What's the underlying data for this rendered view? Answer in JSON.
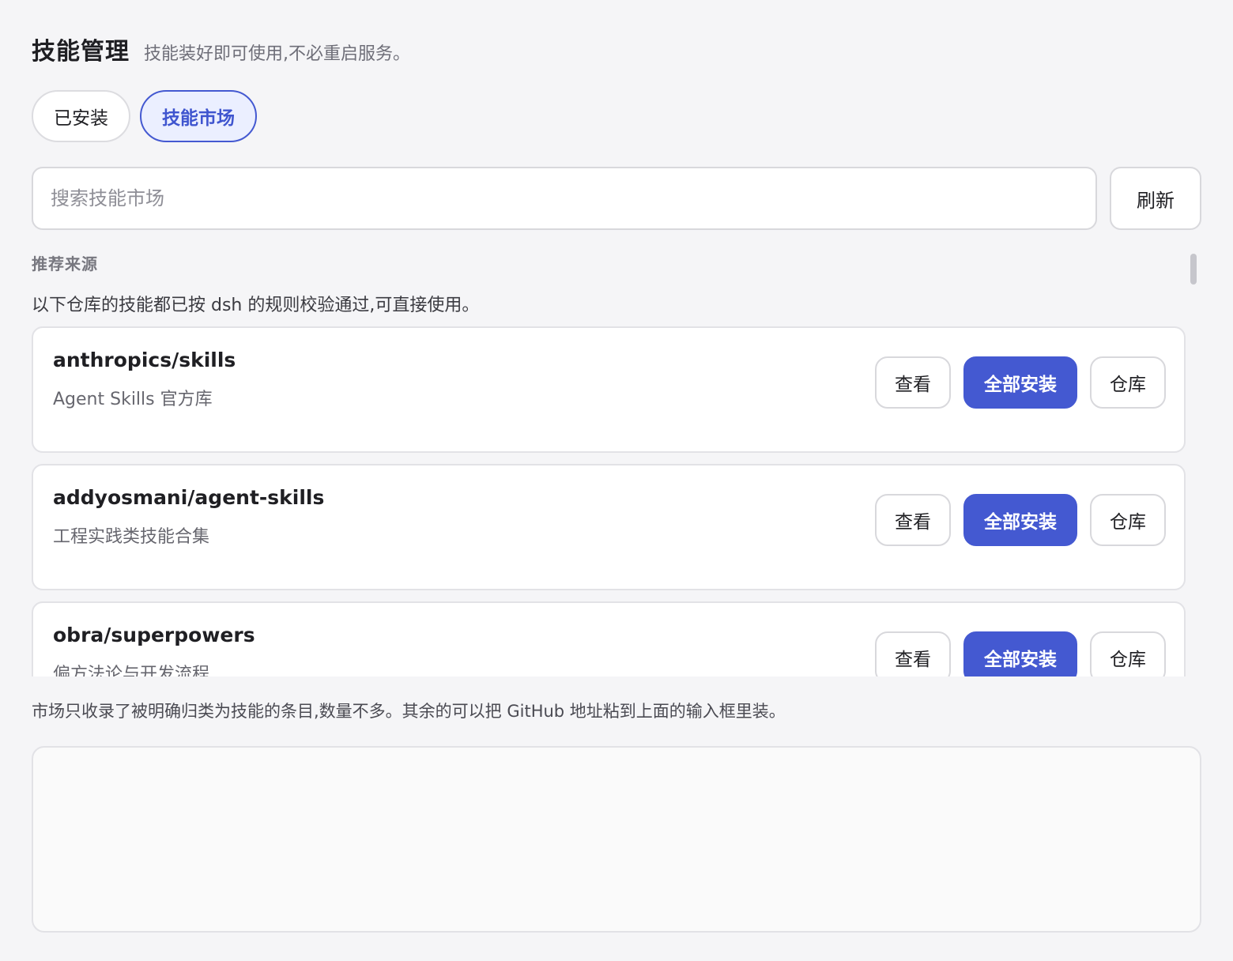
{
  "header": {
    "title": "技能管理",
    "subtitle": "技能装好即可使用,不必重启服务。"
  },
  "tabs": [
    {
      "label": "已安装",
      "active": false
    },
    {
      "label": "技能市场",
      "active": true
    }
  ],
  "search": {
    "value": "",
    "placeholder": "搜索技能市场",
    "refresh_label": "刷新"
  },
  "recommended": {
    "section_label": "推荐来源",
    "description": "以下仓库的技能都已按 dsh 的规则校验通过,可直接使用。",
    "repos": [
      {
        "name": "anthropics/skills",
        "description": "Agent Skills 官方库",
        "view_label": "查看",
        "install_all_label": "全部安装",
        "repo_label": "仓库"
      },
      {
        "name": "addyosmani/agent-skills",
        "description": "工程实践类技能合集",
        "view_label": "查看",
        "install_all_label": "全部安装",
        "repo_label": "仓库"
      },
      {
        "name": "obra/superpowers",
        "description": "偏方法论与开发流程",
        "view_label": "查看",
        "install_all_label": "全部安装",
        "repo_label": "仓库"
      }
    ]
  },
  "footnote": "市场只收录了被明确归类为技能的条目,数量不多。其余的可以把 GitHub 地址粘到上面的输入框里装。",
  "colors": {
    "accent": "#4459d1",
    "accent_light": "#ebefff",
    "background": "#f5f5f7"
  }
}
